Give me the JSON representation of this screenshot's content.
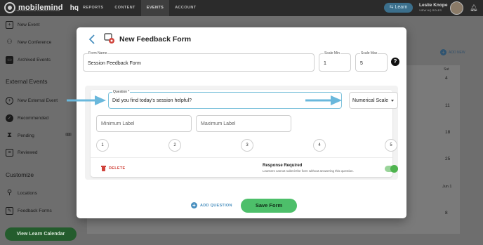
{
  "topbar": {
    "logo": "mobilemind",
    "logo_sub": "THE PROFESSIONAL LEARNING PLATFORM",
    "logo_hq": "hq",
    "nav": [
      "REPORTS",
      "CONTENT",
      "EVENTS",
      "ACCOUNT"
    ],
    "nav_active": "EVENTS",
    "learn_label": "Learn",
    "user_name": "Leslie Knope",
    "user_role": "VIEW HQ ROLES",
    "bell_icon": "bell-icon"
  },
  "sidebar": {
    "items_top": [
      {
        "label": "New Event",
        "icon": "calendar-plus-icon"
      },
      {
        "label": "New Conference",
        "icon": "conference-icon"
      },
      {
        "label": "Archived Events",
        "icon": "archive-icon"
      }
    ],
    "section_external": "External Events",
    "items_external": [
      {
        "label": "New External Event",
        "icon": "plus-circle-icon"
      },
      {
        "label": "Recommended",
        "icon": "check-circle-icon"
      },
      {
        "label": "Pending",
        "icon": "hourglass-icon",
        "badge": "12"
      },
      {
        "label": "Reviewed",
        "icon": "document-icon"
      }
    ],
    "section_customize": "Customize",
    "items_customize": [
      {
        "label": "Locations",
        "icon": "location-icon"
      },
      {
        "label": "Feedback Forms",
        "icon": "feedback-icon"
      }
    ],
    "view_calendar": "View Learn Calendar"
  },
  "calendar": {
    "add_new": "ADD NEW",
    "sat_label": "Sat",
    "numbers": [
      "4",
      "11",
      "18",
      "25",
      "Jun 1",
      "8"
    ]
  },
  "modal": {
    "title": "New Feedback Form",
    "form_name": {
      "label": "Form Name",
      "value": "Session Feedback Form"
    },
    "scale_min": {
      "label": "Scale Min",
      "value": "1"
    },
    "scale_max": {
      "label": "Scale Max",
      "value": "5"
    },
    "help": "?",
    "question": {
      "label": "Question *",
      "value": "Did you find today's session helpful?",
      "type": "Numerical Scale",
      "min_label_placeholder": "Minimum Label",
      "max_label_placeholder": "Maximum Label",
      "scale": [
        "1",
        "2",
        "3",
        "4",
        "5"
      ],
      "delete": "DELETE",
      "required_title": "Response Required",
      "required_sub": "Learners cannot submit the form without answering this question.",
      "required_on": true
    },
    "add_question": "ADD QUESTION",
    "save": "Save Form"
  },
  "colors": {
    "accent": "#4a90bf",
    "save": "#4dbf6a",
    "delete": "#d0433b",
    "arrow": "#6ab8dc"
  }
}
